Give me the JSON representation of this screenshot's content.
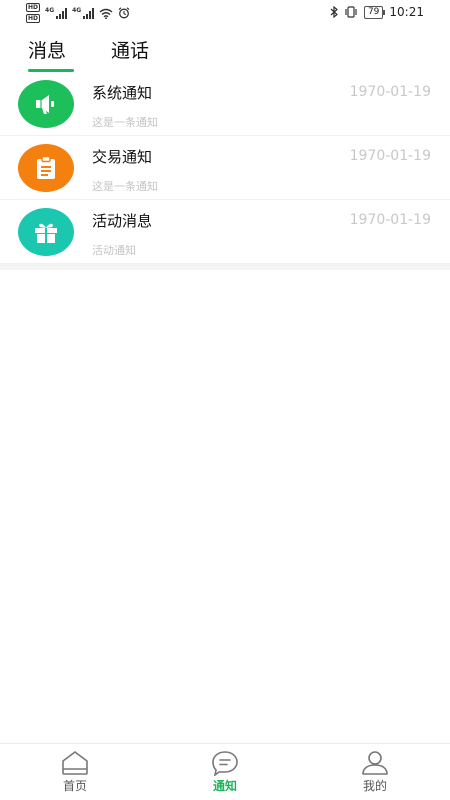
{
  "status_bar": {
    "hd1": "HD",
    "hd2": "HD",
    "sim1": "4G",
    "sim2": "4G",
    "battery": "79",
    "time": "10:21"
  },
  "tabs": [
    {
      "label": "消息"
    },
    {
      "label": "通话"
    }
  ],
  "messages": [
    {
      "title": "系统通知",
      "subtitle": "这是一条通知",
      "date": "1970-01-19",
      "icon": "megaphone-icon",
      "color": "#1dbf5b"
    },
    {
      "title": "交易通知",
      "subtitle": "这是一条通知",
      "date": "1970-01-19",
      "icon": "clipboard-icon",
      "color": "#f4800f"
    },
    {
      "title": "活动消息",
      "subtitle": "活动通知",
      "date": "1970-01-19",
      "icon": "gift-icon",
      "color": "#1cc7b0"
    }
  ],
  "bottom_nav": [
    {
      "label": "首页",
      "icon": "home-icon"
    },
    {
      "label": "通知",
      "icon": "chat-icon",
      "active": true
    },
    {
      "label": "我的",
      "icon": "user-icon"
    }
  ],
  "colors": {
    "accent": "#1fb35a"
  }
}
